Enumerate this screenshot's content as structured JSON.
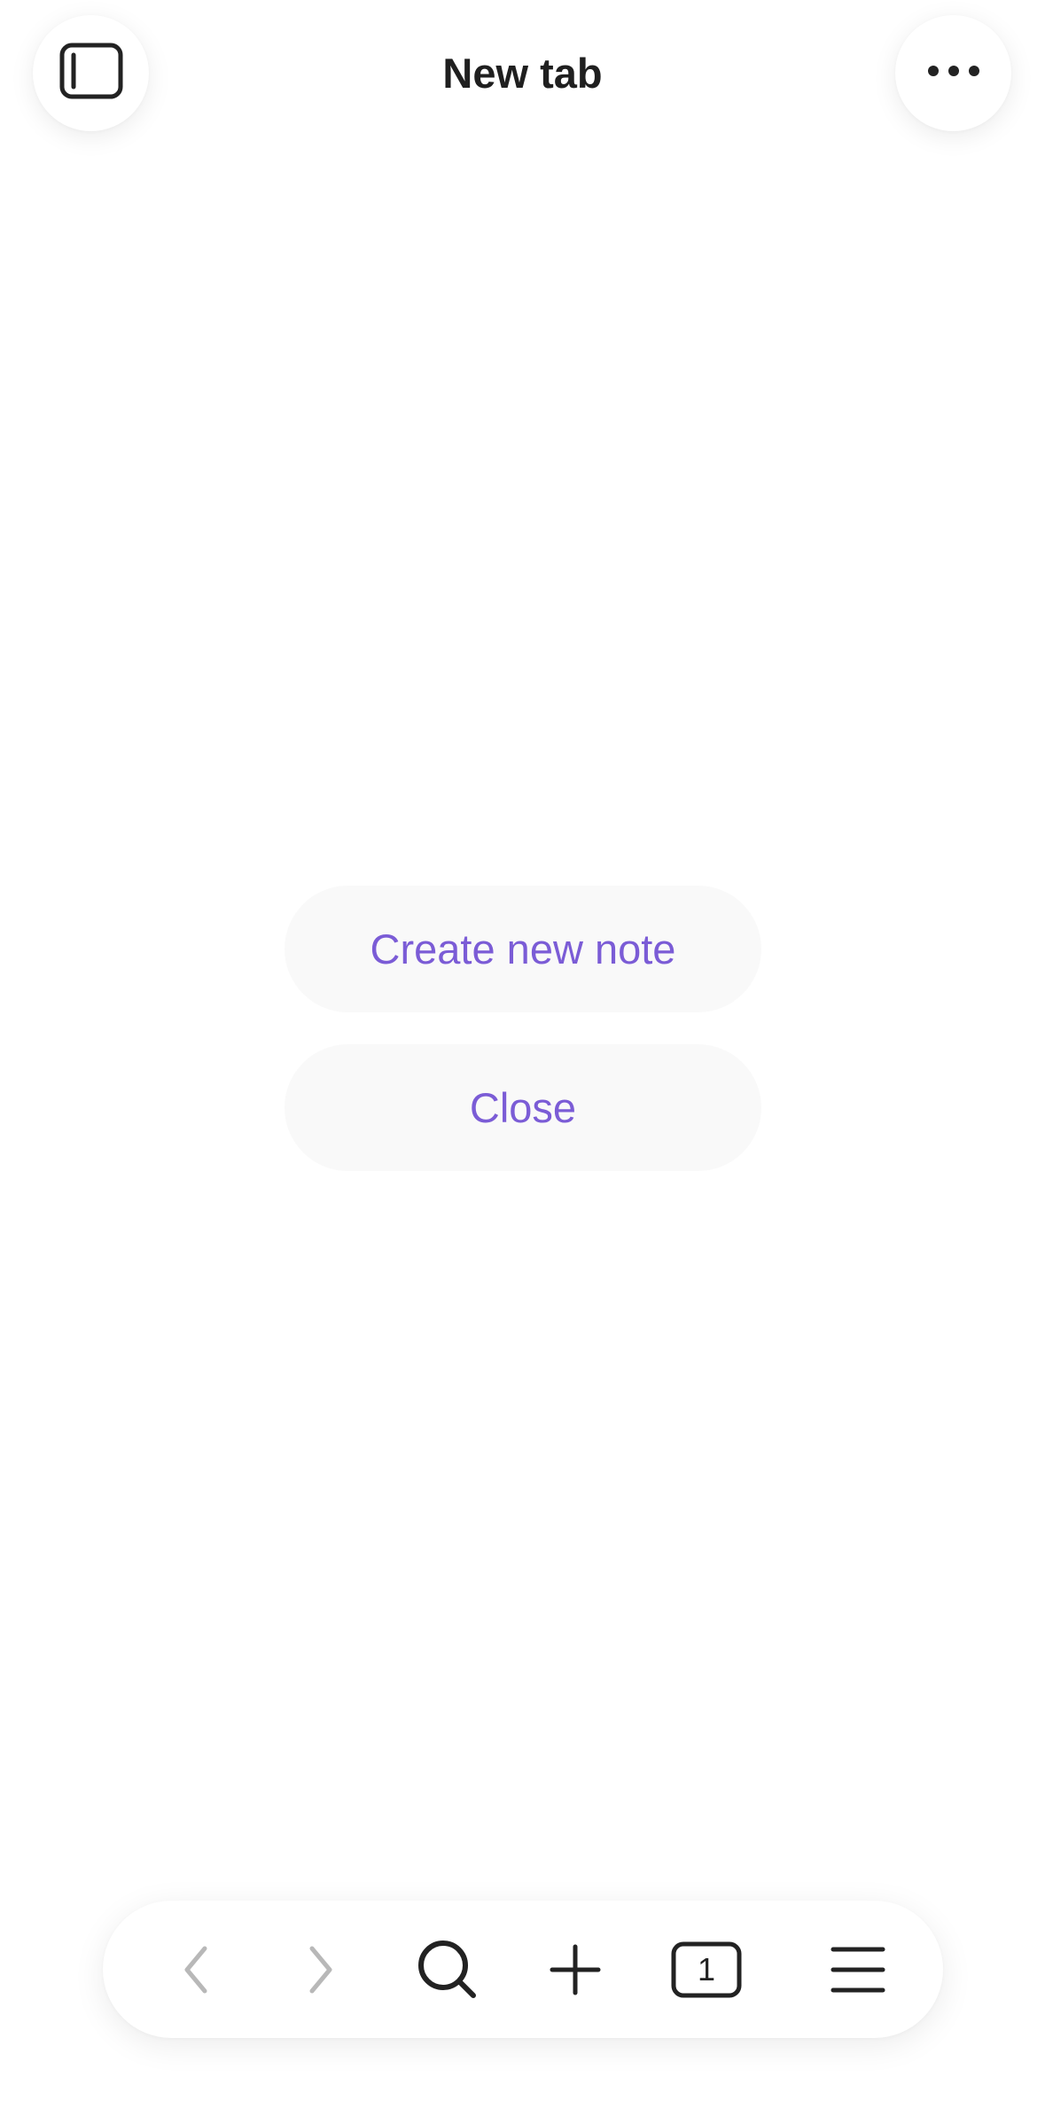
{
  "header": {
    "title": "New tab",
    "left_icon": "sidebar-toggle-icon",
    "right_icon": "more-horizontal-icon"
  },
  "main": {
    "create_label": "Create new note",
    "close_label": "Close"
  },
  "toolbar": {
    "tab_count": "1",
    "icons": [
      "back-arrow-icon",
      "forward-arrow-icon",
      "search-icon",
      "plus-icon",
      "tabs-icon",
      "menu-icon"
    ]
  },
  "colors": {
    "accent": "#7b5cd6",
    "text": "#1f1f1f",
    "disabled": "#b8b8b8",
    "button_bg": "#f9f9f9"
  }
}
